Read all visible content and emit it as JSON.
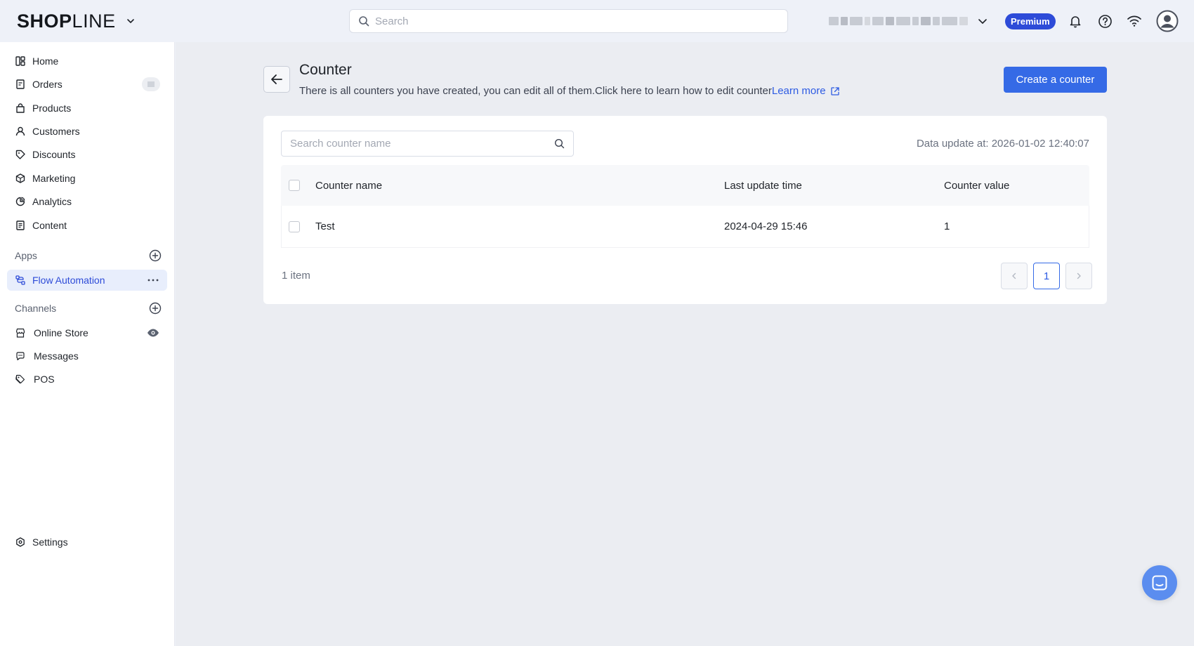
{
  "topbar": {
    "logo_bold": "SH",
    "logo_o": "O",
    "logo_rest_bold": "P",
    "logo_rest": "LINE",
    "search_placeholder": "Search",
    "plan_badge": "Premium",
    "icons": [
      "chevron-down-icon",
      "bell-icon",
      "help-icon",
      "wifi-icon",
      "user-avatar-icon"
    ]
  },
  "sidebar": {
    "items": [
      {
        "label": "Home",
        "icon": "home-icon"
      },
      {
        "label": "Orders",
        "icon": "orders-icon"
      },
      {
        "label": "Products",
        "icon": "products-icon"
      },
      {
        "label": "Customers",
        "icon": "customers-icon"
      },
      {
        "label": "Discounts",
        "icon": "discounts-icon"
      },
      {
        "label": "Marketing",
        "icon": "marketing-icon"
      },
      {
        "label": "Analytics",
        "icon": "analytics-icon"
      },
      {
        "label": "Content",
        "icon": "content-icon"
      }
    ],
    "apps_label": "Apps",
    "apps_items": [
      {
        "label": "Flow Automation",
        "icon": "flow-icon",
        "active": true
      }
    ],
    "channels_label": "Channels",
    "channel_items": [
      {
        "label": "Online Store",
        "icon": "store-icon"
      },
      {
        "label": "Messages",
        "icon": "messages-icon"
      },
      {
        "label": "POS",
        "icon": "pos-icon"
      }
    ],
    "settings_label": "Settings"
  },
  "page": {
    "title": "Counter",
    "description": "There is all counters you have created, you can edit all of them.Click here to learn how to edit counter",
    "learn_more": "Learn more",
    "create_button": "Create a counter"
  },
  "table": {
    "search_placeholder": "Search counter name",
    "data_update": "Data update at: 2026-01-02 12:40:07",
    "columns": [
      "Counter name",
      "Last update time",
      "Counter value"
    ],
    "rows": [
      {
        "name": "Test",
        "updated": "2024-04-29 15:46",
        "value": "1"
      }
    ],
    "count_text": "1 item",
    "current_page": "1"
  },
  "colors": {
    "accent": "#356ae6",
    "premium": "#2d4bd8",
    "link": "#2d5be3",
    "chat": "#5b8def"
  }
}
